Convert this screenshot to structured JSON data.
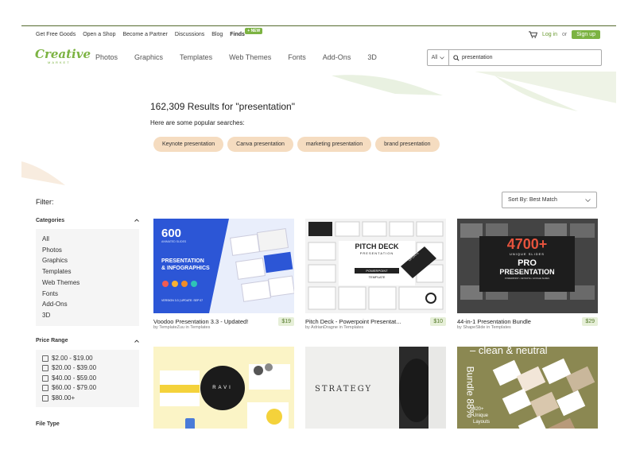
{
  "topbar": {
    "links": [
      "Get Free Goods",
      "Open a Shop",
      "Become a Partner",
      "Discussions",
      "Blog"
    ],
    "finds": "Finds",
    "new_badge": "+ NEW",
    "cart_icon": "cart-icon",
    "login": "Log in",
    "or": "or",
    "signup": "Sign up"
  },
  "logo": {
    "main": "Creative",
    "sub": "MARKET"
  },
  "nav": {
    "items": [
      "Photos",
      "Graphics",
      "Templates",
      "Web Themes",
      "Fonts",
      "Add-Ons",
      "3D"
    ]
  },
  "search": {
    "category": "All",
    "value": "presentation",
    "icon": "search-icon"
  },
  "hero": {
    "results_count": "162,309 Results for \"presentation\"",
    "popular_label": "Here are some popular searches:",
    "chips": [
      "Keynote presentation",
      "Canva presentation",
      "marketing presentation",
      "brand presentation"
    ]
  },
  "filter": {
    "title": "Filter:"
  },
  "sort": {
    "label": "Sort By: Best Match"
  },
  "sidebar": {
    "categories_label": "Categories",
    "categories": [
      "All",
      "Photos",
      "Graphics",
      "Templates",
      "Web Themes",
      "Fonts",
      "Add-Ons",
      "3D"
    ],
    "price_label": "Price Range",
    "prices": [
      "$2.00 - $19.00",
      "$20.00 - $39.00",
      "$40.00 - $59.00",
      "$60.00 - $79.00",
      "$80.00+"
    ],
    "file_type_label": "File Type"
  },
  "products": [
    {
      "title": "Voodoo Presentation 3.3 - Updated!",
      "by": "by TemplateZuu in Templates",
      "price": "$19",
      "thumb_text": [
        "600",
        "ANIMATED SLIDES",
        "PRESENTATION",
        "& INFOGRAPHICS",
        "VERSION 3.3 | UPDATE: SEP 07"
      ]
    },
    {
      "title": "Pitch Deck - Powerpoint Presentat...",
      "by": "by AdrianDragne in Templates",
      "price": "$10",
      "thumb_text": [
        "PITCH DECK",
        "PRESENTATION",
        "POWERPOINT",
        "TEMPLATE",
        "UPDATE"
      ]
    },
    {
      "title": "44-in-1 Presentation Bundle",
      "by": "by ShapeSlide in Templates",
      "price": "$29",
      "thumb_text": [
        "4700+",
        "UNIQUE SLIDES",
        "PRO",
        "PRESENTATION",
        "POWERPOINT • KEYNOTE • GOOGLE SLIDES"
      ]
    },
    {
      "title": "",
      "by": "",
      "price": "",
      "thumb_text": [
        "RAVI"
      ]
    },
    {
      "title": "",
      "by": "",
      "price": "",
      "thumb_text": [
        "STRATEGY"
      ]
    },
    {
      "title": "",
      "by": "",
      "price": "",
      "thumb_text": [
        "– clean & neutral",
        "420+",
        "Unique",
        "Layouts",
        "Bundle 88%"
      ]
    }
  ],
  "colors": {
    "brand_green": "#7cb342",
    "chip_bg": "#f5dcc0",
    "price_bg": "#e6efd8"
  }
}
